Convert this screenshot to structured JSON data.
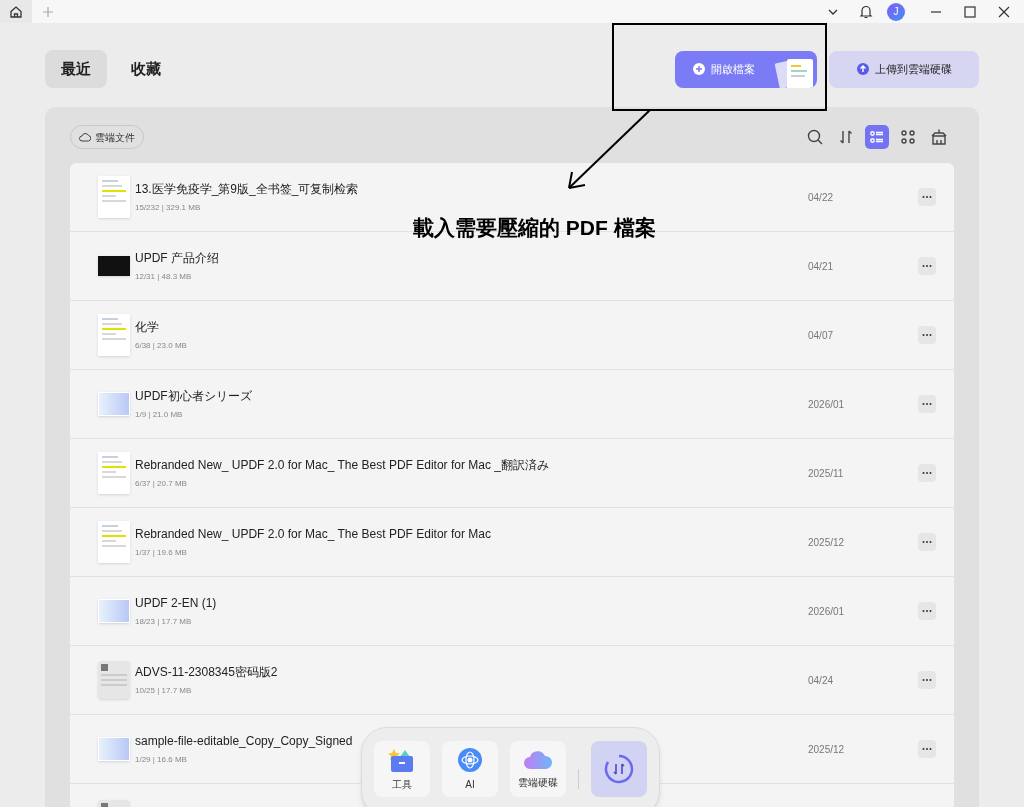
{
  "tabs": [
    {
      "label": "最近",
      "selected": true
    },
    {
      "label": "收藏",
      "selected": false
    }
  ],
  "open_button": {
    "label": "開啟檔案"
  },
  "upload_button": {
    "label": "上傳到雲端硬碟"
  },
  "cloud_chip": {
    "label": "雲端文件"
  },
  "view_tools": [
    {
      "kind": "search",
      "selected": false
    },
    {
      "kind": "sort",
      "selected": false
    },
    {
      "kind": "list",
      "selected": true
    },
    {
      "kind": "grid",
      "selected": false
    },
    {
      "kind": "clean",
      "selected": false
    }
  ],
  "files": [
    {
      "name": "13.医学免疫学_第9版_全书签_可复制检索",
      "meta": "15/232 | 329.1 MB",
      "date": "04/22",
      "kind": "doc"
    },
    {
      "name": "UPDF 产品介绍",
      "meta": "12/31 | 48.3 MB",
      "date": "04/21",
      "kind": "dark"
    },
    {
      "name": "化学",
      "meta": "6/38 | 23.0 MB",
      "date": "04/07",
      "kind": "doc"
    },
    {
      "name": "UPDF初心者シリーズ",
      "meta": "1/9 | 21.0 MB",
      "date": "2026/01",
      "kind": "wide"
    },
    {
      "name": "Rebranded New_ UPDF 2.0 for Mac_ The Best PDF Editor for Mac _翻訳済み",
      "meta": "6/37 | 20.7 MB",
      "date": "2025/11",
      "kind": "doc"
    },
    {
      "name": "Rebranded New_ UPDF 2.0 for Mac_ The Best PDF Editor for Mac",
      "meta": "1/37 | 19.6 MB",
      "date": "2025/12",
      "kind": "doc"
    },
    {
      "name": "UPDF 2-EN (1)",
      "meta": "18/23 | 17.7 MB",
      "date": "2026/01",
      "kind": "wide"
    },
    {
      "name": "ADVS-11-2308345密码版2",
      "meta": "10/25 | 17.7 MB",
      "date": "04/24",
      "kind": "locked"
    },
    {
      "name": "sample-file-editable_Copy_Copy_Signed",
      "meta": "1/29 | 16.6 MB",
      "date": "2025/12",
      "kind": "wide"
    }
  ],
  "dock": [
    {
      "kind": "tools",
      "label": "工具"
    },
    {
      "kind": "ai",
      "label": "AI"
    },
    {
      "kind": "cloud",
      "label": "雲端硬碟"
    },
    {
      "kind": "convert"
    }
  ],
  "avatar": {
    "initial": "J"
  },
  "annotation": {
    "text": "載入需要壓縮的 PDF 檔案"
  }
}
